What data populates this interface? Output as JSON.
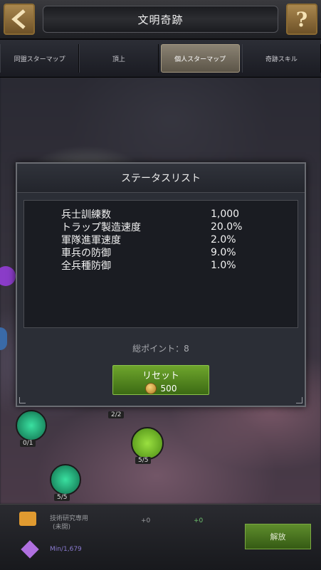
{
  "header": {
    "title": "文明奇跡",
    "help_glyph": "?"
  },
  "tabs": [
    {
      "label": "同盟スターマップ",
      "active": false
    },
    {
      "label": "頂上",
      "active": false
    },
    {
      "label": "個人スターマップ",
      "active": true
    },
    {
      "label": "奇跡スキル",
      "active": false
    }
  ],
  "background": {
    "node_labels": [
      "2/2",
      "0/1",
      "5/5",
      "5/5"
    ]
  },
  "modal": {
    "title": "ステータスリスト",
    "stats": [
      {
        "name": "兵士訓練数",
        "value": "1,000"
      },
      {
        "name": "トラップ製造速度",
        "value": "20.0%"
      },
      {
        "name": "軍隊進軍速度",
        "value": "2.0%"
      },
      {
        "name": "車兵の防御",
        "value": "9.0%"
      },
      {
        "name": "全兵種防御",
        "value": "1.0%"
      }
    ],
    "total_points": "総ポイント：8",
    "reset_button": {
      "label": "リセット",
      "cost": "500"
    }
  },
  "bottom_panel": {
    "item_text": "技術研究専用",
    "item_sub": "(未開)",
    "count_a": "+0",
    "count_b": "+0",
    "resource_value": "Min/1,679",
    "unlock_label": "解放"
  },
  "colors": {
    "accent_green": "#5e9a24",
    "gold": "#a9874e"
  }
}
